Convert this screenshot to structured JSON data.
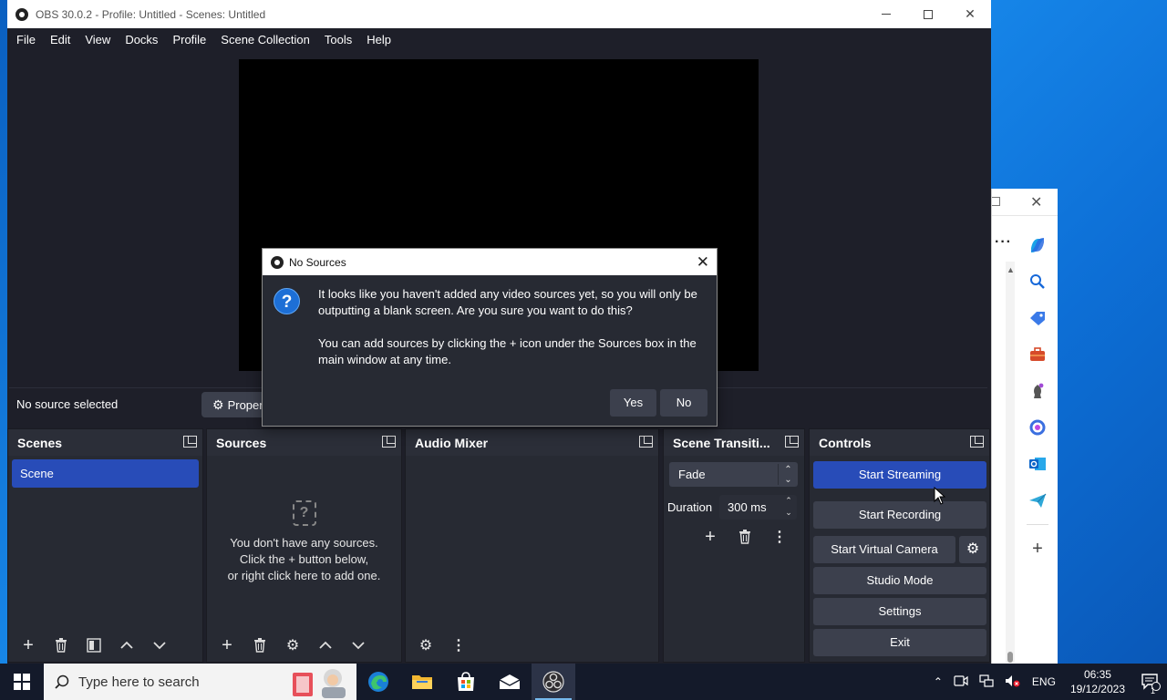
{
  "window": {
    "title": "OBS 30.0.2 - Profile: Untitled - Scenes: Untitled"
  },
  "menu": [
    "File",
    "Edit",
    "View",
    "Docks",
    "Profile",
    "Scene Collection",
    "Tools",
    "Help"
  ],
  "context": {
    "no_source": "No source selected",
    "properties_label": "Properties"
  },
  "docks": {
    "scenes": {
      "title": "Scenes",
      "items": [
        "Scene"
      ]
    },
    "sources": {
      "title": "Sources",
      "empty_line1": "You don't have any sources.",
      "empty_line2": "Click the + button below,",
      "empty_line3": "or right click here to add one."
    },
    "audio": {
      "title": "Audio Mixer"
    },
    "transitions": {
      "title": "Scene Transiti...",
      "selected": "Fade",
      "duration_label": "Duration",
      "duration_value": "300 ms"
    },
    "controls": {
      "title": "Controls",
      "start_streaming": "Start Streaming",
      "start_recording": "Start Recording",
      "start_virtual_camera": "Start Virtual Camera",
      "studio_mode": "Studio Mode",
      "settings": "Settings",
      "exit": "Exit"
    }
  },
  "dialog": {
    "title": "No Sources",
    "message1": "It looks like you haven't added any video sources yet, so you will only be outputting a blank screen. Are you sure you want to do this?",
    "message2": "You can add sources by clicking the + icon under the Sources box in the main window at any time.",
    "yes": "Yes",
    "no": "No"
  },
  "taskbar": {
    "search_placeholder": "Type here to search",
    "language": "ENG",
    "time": "06:35",
    "date": "19/12/2023",
    "notification_count": "1"
  },
  "colors": {
    "obs_bg": "#1e1f29",
    "dock_bg": "#272a33",
    "button": "#3c404d",
    "accent": "#284cb8",
    "desktop": "#0a6fd0"
  }
}
